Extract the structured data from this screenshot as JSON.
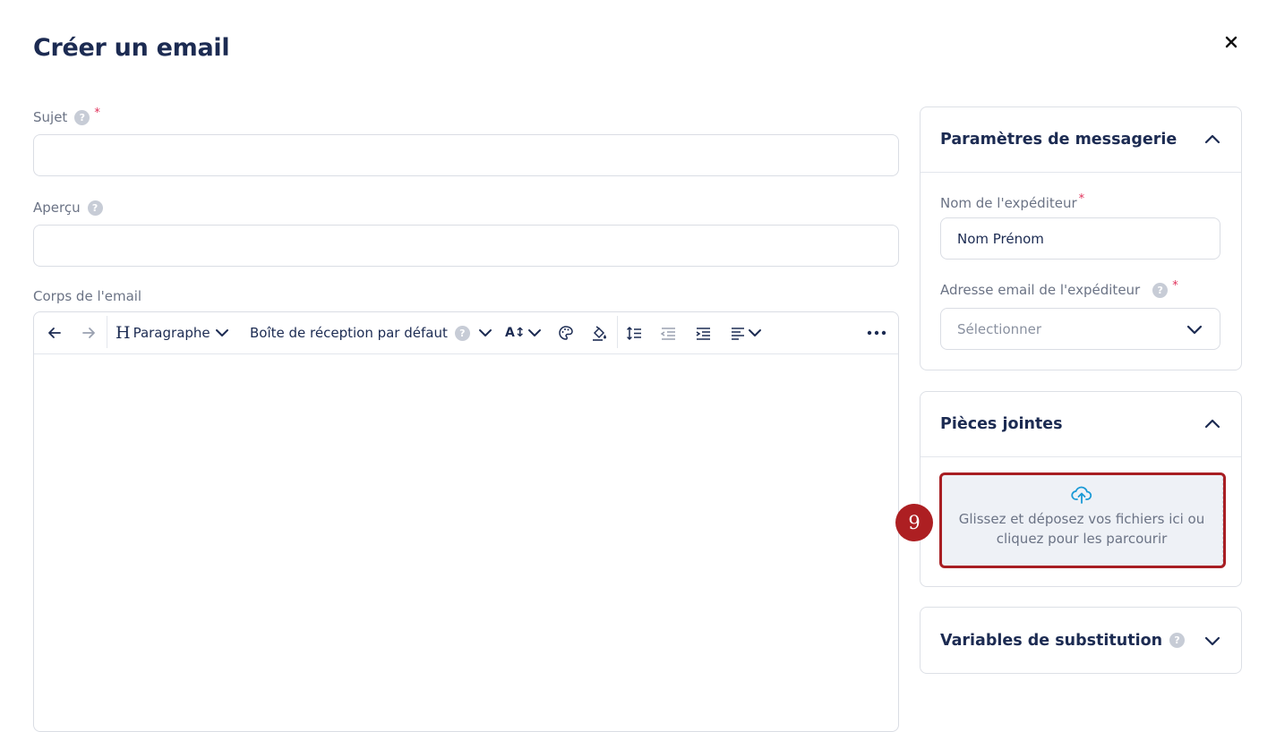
{
  "header": {
    "title": "Créer un email"
  },
  "form": {
    "subject": {
      "label": "Sujet",
      "help": "?",
      "required": "*",
      "value": "",
      "placeholder": ""
    },
    "preview": {
      "label": "Aperçu",
      "help": "?",
      "value": "",
      "placeholder": ""
    },
    "body": {
      "label": "Corps de l'email"
    }
  },
  "toolbar": {
    "heading_glyph": "H",
    "block_format": "Paragraphe",
    "inbox_label": "Boîte de réception par défaut",
    "inbox_help": "?",
    "font_size_glyph": "A↕"
  },
  "settings_panel": {
    "title": "Paramètres de messagerie",
    "sender_name": {
      "label": "Nom de l'expéditeur",
      "required": "*",
      "value": "Nom Prénom"
    },
    "sender_email": {
      "label": "Adresse email de l'expéditeur",
      "help": "?",
      "required": "*",
      "placeholder": "Sélectionner"
    }
  },
  "attachments_panel": {
    "title": "Pièces jointes",
    "dropzone_line1": "Glissez et déposez vos fichiers ici ou",
    "dropzone_line2": "cliquez pour les parcourir"
  },
  "variables_panel": {
    "title": "Variables de substitution",
    "help": "?"
  },
  "annotation": {
    "step": "9"
  },
  "colors": {
    "title": "#1c2b52",
    "required": "#e0315a",
    "highlight": "#a81e23",
    "upload_icon": "#1a9ad6"
  }
}
